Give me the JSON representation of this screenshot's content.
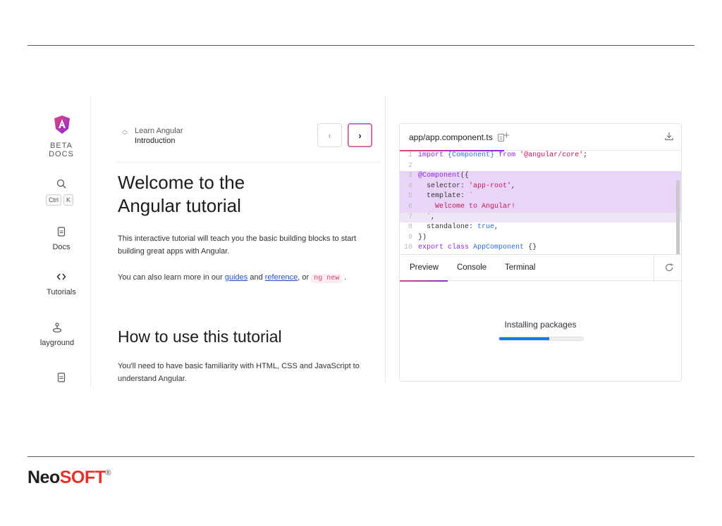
{
  "slide": {
    "logo_neo": "Neo",
    "logo_soft": "SOFT",
    "logo_reg": "®"
  },
  "rail": {
    "brand": "BETA\nDOCS",
    "kbd_ctrl": "Ctrl",
    "kbd_k": "K",
    "items": [
      {
        "label": "Docs",
        "icon": "docs-icon"
      },
      {
        "label": "Tutorials",
        "icon": "code-brackets-icon"
      },
      {
        "label": "layground",
        "icon": "joystick-icon"
      },
      {
        "label": "",
        "icon": "reference-icon"
      }
    ]
  },
  "tutorial": {
    "breadcrumb_parent": "Learn Angular",
    "breadcrumb_current": "Introduction",
    "prev_label": "‹",
    "next_label": "›",
    "heading_line1": "Welcome to the",
    "heading_line2": "Angular tutorial",
    "para1": "This interactive tutorial will teach you the basic building blocks to start building great apps with Angular.",
    "para2_prefix": "You can also learn more in our ",
    "link_guides": "guides",
    "para2_and": " and ",
    "link_reference": "reference",
    "para2_or": ", or ",
    "code_ng_new": "ng new",
    "para2_end": " .",
    "heading2": "How to use this tutorial",
    "para3": "You'll need to have basic familiarity with HTML, CSS and JavaScript to understand Angular."
  },
  "editor": {
    "file_tab": "app/app.component.ts",
    "add_tab": "+",
    "lines": [
      {
        "n": "1",
        "text": "import {Component} from '@angular/core';"
      },
      {
        "n": "2",
        "text": ""
      },
      {
        "n": "3",
        "text": "@Component({"
      },
      {
        "n": "4",
        "text": "  selector: 'app-root',"
      },
      {
        "n": "5",
        "text": "  template: `"
      },
      {
        "n": "6",
        "text": "    Welcome to Angular!"
      },
      {
        "n": "7",
        "text": "  `,"
      },
      {
        "n": "8",
        "text": "  standalone: true,"
      },
      {
        "n": "9",
        "text": "})"
      },
      {
        "n": "10",
        "text": "export class AppComponent {}"
      }
    ]
  },
  "preview": {
    "tabs": [
      "Preview",
      "Console",
      "Terminal"
    ],
    "active_tab": "Preview",
    "status": "Installing packages",
    "progress": 0.6
  },
  "colors": {
    "accent_pink": "#e0457b",
    "accent_purple": "#8b2bde",
    "progress_blue": "#1a73e8",
    "brand_red": "#e8312a"
  }
}
